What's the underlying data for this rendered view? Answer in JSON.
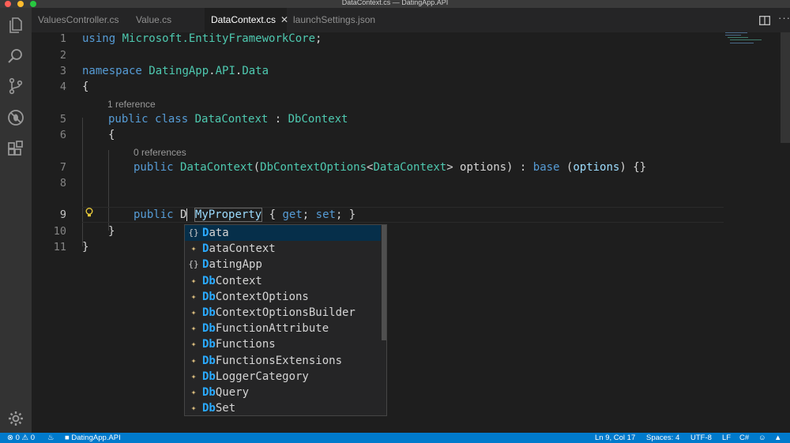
{
  "window": {
    "title": "DataContext.cs — DatingApp.API"
  },
  "tabs": [
    {
      "label": "ValuesController.cs"
    },
    {
      "label": "Value.cs"
    },
    {
      "label": "DataContext.cs",
      "active": true
    },
    {
      "label": "launchSettings.json"
    }
  ],
  "code": {
    "line_numbers": [
      "1",
      "2",
      "3",
      "4",
      "5",
      "6",
      "7",
      "8",
      "9",
      "10",
      "11"
    ],
    "l1": {
      "kw": "using",
      "ns": "Microsoft.EntityFrameworkCore",
      "punct": ";"
    },
    "l3": {
      "kw": "namespace",
      "ns1": "DatingApp",
      "dot1": ".",
      "ns2": "API",
      "dot2": ".",
      "ns3": "Data"
    },
    "l4": "{",
    "lens1": "1 reference",
    "l5": {
      "kw1": "public",
      "kw2": "class",
      "name": "DataContext",
      "sep": " : ",
      "base": "DbContext"
    },
    "l6": "{",
    "lens2": "0 references",
    "l7": {
      "kw": "public",
      "name": "DataContext",
      "p1": "(",
      "t1": "DbContextOptions",
      "p2": "<",
      "t2": "DataContext",
      "p3": "> options) : ",
      "kw2": "base",
      "p4": " (",
      "arg": "options",
      "p5": ") {}"
    },
    "l9": {
      "kw": "public",
      "typed": "D",
      "ghost_name": "MyProperty",
      "brace1": " { ",
      "get": "get",
      "semi1": "; ",
      "set": "set",
      "semi2": "; }"
    },
    "l10": "}",
    "l11": "}"
  },
  "suggestions": {
    "match_prefix": "D",
    "items": [
      {
        "icon": "module-icon",
        "glyph": "{}",
        "rest": "ata",
        "selected": true
      },
      {
        "icon": "class-icon",
        "glyph": "✦",
        "rest": "ataContext"
      },
      {
        "icon": "module-icon",
        "glyph": "{}",
        "rest": "atingApp"
      },
      {
        "icon": "class-icon",
        "glyph": "✦",
        "prefix": "Db",
        "rest": "Context"
      },
      {
        "icon": "class-icon",
        "glyph": "✦",
        "prefix": "Db",
        "rest": "ContextOptions"
      },
      {
        "icon": "class-icon",
        "glyph": "✦",
        "prefix": "Db",
        "rest": "ContextOptionsBuilder"
      },
      {
        "icon": "class-icon",
        "glyph": "✦",
        "prefix": "Db",
        "rest": "FunctionAttribute"
      },
      {
        "icon": "class-icon",
        "glyph": "✦",
        "prefix": "Db",
        "rest": "Functions"
      },
      {
        "icon": "class-icon",
        "glyph": "✦",
        "prefix": "Db",
        "rest": "FunctionsExtensions"
      },
      {
        "icon": "class-icon",
        "glyph": "✦",
        "prefix": "Db",
        "rest": "LoggerCategory"
      },
      {
        "icon": "class-icon",
        "glyph": "✦",
        "prefix": "Db",
        "rest": "Query"
      },
      {
        "icon": "class-icon",
        "glyph": "✦",
        "prefix": "Db",
        "rest": "Set"
      }
    ]
  },
  "statusbar": {
    "errors": "0",
    "warnings": "0",
    "project": "DatingApp.API",
    "position": "Ln 9, Col 17",
    "spaces": "Spaces: 4",
    "encoding": "UTF-8",
    "eol": "LF",
    "language": "C#"
  },
  "colors": {
    "accent": "#007acc",
    "keyword": "#569cd6",
    "type": "#4ec9b0",
    "highlight": "#2aaaff"
  }
}
